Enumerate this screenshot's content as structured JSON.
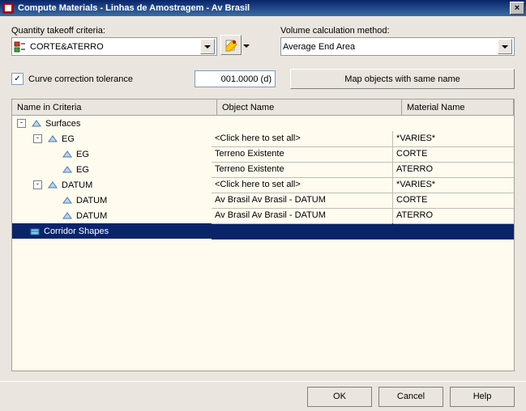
{
  "window": {
    "title": "Compute Materials - Linhas de Amostragem - Av Brasil"
  },
  "criteria": {
    "label": "Quantity takeoff criteria:",
    "value": "CORTE&ATERRO"
  },
  "volume": {
    "label": "Volume calculation method:",
    "value": "Average End Area"
  },
  "curve_correction": {
    "label": "Curve correction tolerance",
    "value": "001.0000 (d)"
  },
  "map_button": "Map objects with same name",
  "grid": {
    "headers": {
      "name": "Name in Criteria",
      "object": "Object Name",
      "material": "Material Name"
    },
    "rows": [
      {
        "indent": 0,
        "expander": "-",
        "icon": "surfaces",
        "label": "Surfaces",
        "obj": "",
        "mat": "",
        "cells": false
      },
      {
        "indent": 1,
        "expander": "-",
        "icon": "surface",
        "label": "EG",
        "obj": "<Click here to set all>",
        "mat": "*VARIES*",
        "cells": true
      },
      {
        "indent": 2,
        "expander": "",
        "icon": "surface",
        "label": "EG",
        "obj": "Terreno Existente",
        "mat": "CORTE",
        "cells": true
      },
      {
        "indent": 2,
        "expander": "",
        "icon": "surface",
        "label": "EG",
        "obj": "Terreno Existente",
        "mat": "ATERRO",
        "cells": true
      },
      {
        "indent": 1,
        "expander": "-",
        "icon": "surface",
        "label": "DATUM",
        "obj": "<Click here to set all>",
        "mat": "*VARIES*",
        "cells": true
      },
      {
        "indent": 2,
        "expander": "",
        "icon": "surface",
        "label": "DATUM",
        "obj": "Av Brasil Av Brasil - DATUM",
        "mat": "CORTE",
        "cells": true
      },
      {
        "indent": 2,
        "expander": "",
        "icon": "surface",
        "label": "DATUM",
        "obj": "Av Brasil Av Brasil - DATUM",
        "mat": "ATERRO",
        "cells": true
      },
      {
        "indent": 0,
        "expander": "",
        "icon": "corridor",
        "label": "Corridor Shapes",
        "obj": "",
        "mat": "",
        "cells": true,
        "selected": true
      }
    ]
  },
  "buttons": {
    "ok": "OK",
    "cancel": "Cancel",
    "help": "Help"
  }
}
